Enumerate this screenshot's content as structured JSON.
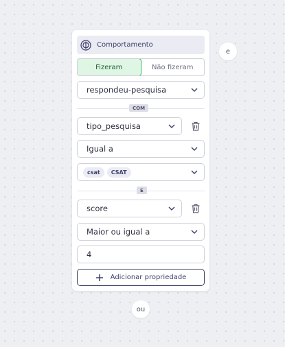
{
  "card": {
    "header_title": "Comportamento",
    "toggle": {
      "active_label": "Fizeram",
      "inactive_label": "Não fizeram"
    },
    "event_select": "respondeu-pesquisa",
    "with_separator": "COM",
    "property1": {
      "name": "tipo_pesquisa",
      "operator": "Igual a",
      "values": [
        "csat",
        "CSAT"
      ]
    },
    "and_separator": "E",
    "property2": {
      "name": "score",
      "operator": "Maior ou igual a",
      "value": "4"
    },
    "add_property_label": "Adicionar propriedade"
  },
  "and_connector": "e",
  "or_connector": "ou",
  "colors": {
    "accent_green": "#37b565",
    "active_bg": "#dff6e4",
    "brand_navy": "#3b3f6b"
  }
}
